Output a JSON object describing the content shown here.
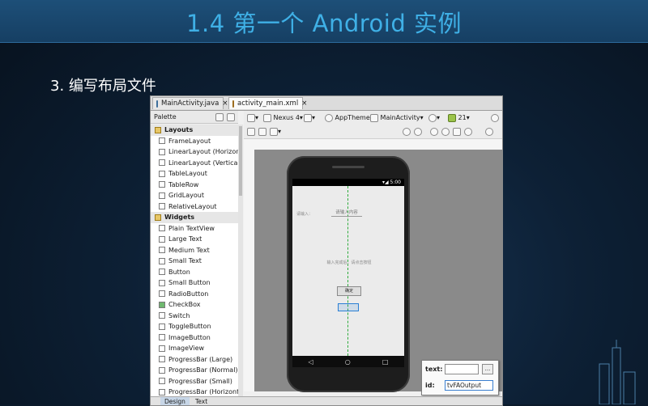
{
  "slide": {
    "title": "1.4 第一个 Android 实例",
    "subtitle": "3. 编写布局文件"
  },
  "ide": {
    "tabs": [
      {
        "label": "MainActivity.java",
        "close": "×"
      },
      {
        "label": "activity_main.xml",
        "close": "×"
      }
    ],
    "palette": {
      "title": "Palette",
      "layouts_label": "Layouts",
      "layouts": [
        "FrameLayout",
        "LinearLayout (Horizontal)",
        "LinearLayout (Vertical)",
        "TableLayout",
        "TableRow",
        "GridLayout",
        "RelativeLayout"
      ],
      "widgets_label": "Widgets",
      "widgets": [
        "Plain TextView",
        "Large Text",
        "Medium Text",
        "Small Text",
        "Button",
        "Small Button",
        "RadioButton",
        "CheckBox",
        "Switch",
        "ToggleButton",
        "ImageButton",
        "ImageView",
        "ProgressBar (Large)",
        "ProgressBar (Normal)",
        "ProgressBar (Small)",
        "ProgressBar (Horizontal)"
      ]
    },
    "toolbar": {
      "device": "Nexus 4",
      "theme": "AppTheme",
      "activity": "MainActivity",
      "api": "21"
    },
    "phone": {
      "time": "5:00",
      "label_input": "请输入：",
      "hint": "请输入内容",
      "output_text": "输入完成后，请点击按钮",
      "button": "确定"
    },
    "properties": {
      "text_label": "text:",
      "text_value": "",
      "browse": "...",
      "id_label": "id:",
      "id_value": "tvFAOutput"
    },
    "bottom_tabs": [
      "Design",
      "Text"
    ]
  },
  "colors": {
    "title": "#3fb0e6",
    "accent": "#2a7fd4",
    "guide": "#2cab3a"
  }
}
